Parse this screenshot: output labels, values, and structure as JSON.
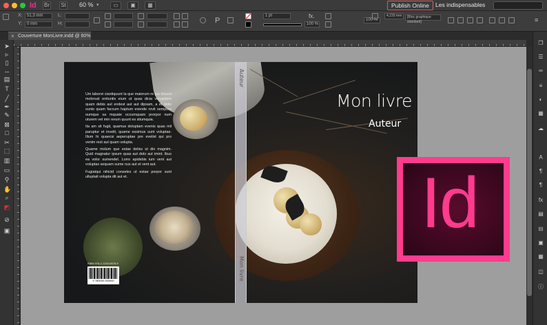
{
  "appbar": {
    "app_icon": "Id",
    "btn_1": "Br",
    "btn_2": "St",
    "zoom": "60 %",
    "publish": "Publish Online",
    "workspace": "Les indispensables"
  },
  "control": {
    "x_label": "X:",
    "y_label": "Y:",
    "l_label": "L:",
    "h_label": "H:",
    "x_value": "51,3 mm",
    "y_value": "0 mm",
    "stroke_weight": "1 pt",
    "percent_1": "100 %",
    "percent_2": "100 %",
    "offset": "4,233 mm",
    "object_style": "[Bloc graphique standard]"
  },
  "document_tab": {
    "title": "Couverture MonLivre.indd @ 60%"
  },
  "cover": {
    "back_paragraphs": [
      "Um laborei ciantiquunt la que maiorum re pia dissed molorust enituntis eium ut quas dicia volupidem quam debis aut endest aut aut dipsam, a et dolis sunto quam faccum haptum evende rovit sempore oumque sa mquate occumquam prorpor num uturem vel min rerum quunt es stiumquia.",
      "Ita am sit fugit, quamus doluptam evenis quas mil paruptur et invelit, quame essimus sunt voluptae. Illum hi quaecsi aeperuptae pre evelist qui pro venim rest aut quam volupta.",
      "Quame molum que estae deliss ut dis magnim. Quid magnatur ipsum quas aut dolo aut imint. Ibus ea volor sumendel. Lorro apidebis ium vent aut voluptas sequam sume nus aut et vent aut.",
      "Fugiatqui nihicid conseles ut estae porpor sunt ulluptati volupta dit aut et."
    ],
    "isbn": "ISBN 978-2-1234-5678-9",
    "barcode_number": "9 780000 000000",
    "spine_top": "Auteur",
    "spine_bottom": "Mon livre",
    "title": "Mon livre",
    "author": "Auteur"
  },
  "logo": {
    "text": "Id",
    "accent": "#ff3b8e",
    "background": "#3c0820"
  },
  "icons": {
    "tools": [
      "selection-icon",
      "direct-selection-icon",
      "page-icon",
      "gap-icon",
      "content-collector-icon",
      "type-icon",
      "line-icon",
      "pen-icon",
      "pencil-icon",
      "rectangle-frame-icon",
      "rectangle-icon",
      "scissors-icon",
      "free-transform-icon",
      "gradient-icon",
      "note-icon",
      "eyedropper-icon",
      "hand-icon",
      "zoom-icon",
      "fill-stroke-icon",
      "view-mode-icon"
    ],
    "panels": [
      "pages-icon",
      "layers-icon",
      "links-icon",
      "stroke-icon",
      "color-icon",
      "swatches-icon",
      "cc-libraries-icon",
      "character-icon",
      "paragraph-icon",
      "effects-icon",
      "text-wrap-icon",
      "align-icon",
      "object-styles-icon"
    ]
  }
}
